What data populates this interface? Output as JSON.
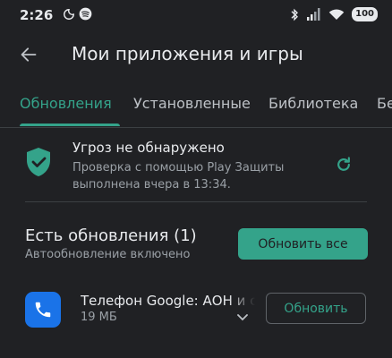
{
  "status_bar": {
    "time": "2:26",
    "battery": "100",
    "icons": [
      "moon-icon",
      "spotify-icon",
      "bluetooth-icon",
      "signal-icon",
      "wifi-icon",
      "battery-icon"
    ]
  },
  "header": {
    "title": "Мои приложения и игры"
  },
  "tabs": [
    {
      "label": "Обновления",
      "active": true
    },
    {
      "label": "Установленные",
      "active": false
    },
    {
      "label": "Библиотека",
      "active": false
    },
    {
      "label": "Бе",
      "active": false
    }
  ],
  "protect": {
    "title": "Угроз не обнаружено",
    "description": "Проверка с помощью Play Защиты выполнена вчера в 13:34."
  },
  "updates": {
    "title": "Есть обновления (1)",
    "subtitle": "Автообновление включено",
    "update_all_label": "Обновить все"
  },
  "apps": [
    {
      "name": "Телефон Google: АОН и спам",
      "size": "19 МБ",
      "update_label": "Обновить"
    }
  ],
  "colors": {
    "accent": "#34a38a",
    "background": "#202124",
    "app_icon": "#1a73e8"
  }
}
